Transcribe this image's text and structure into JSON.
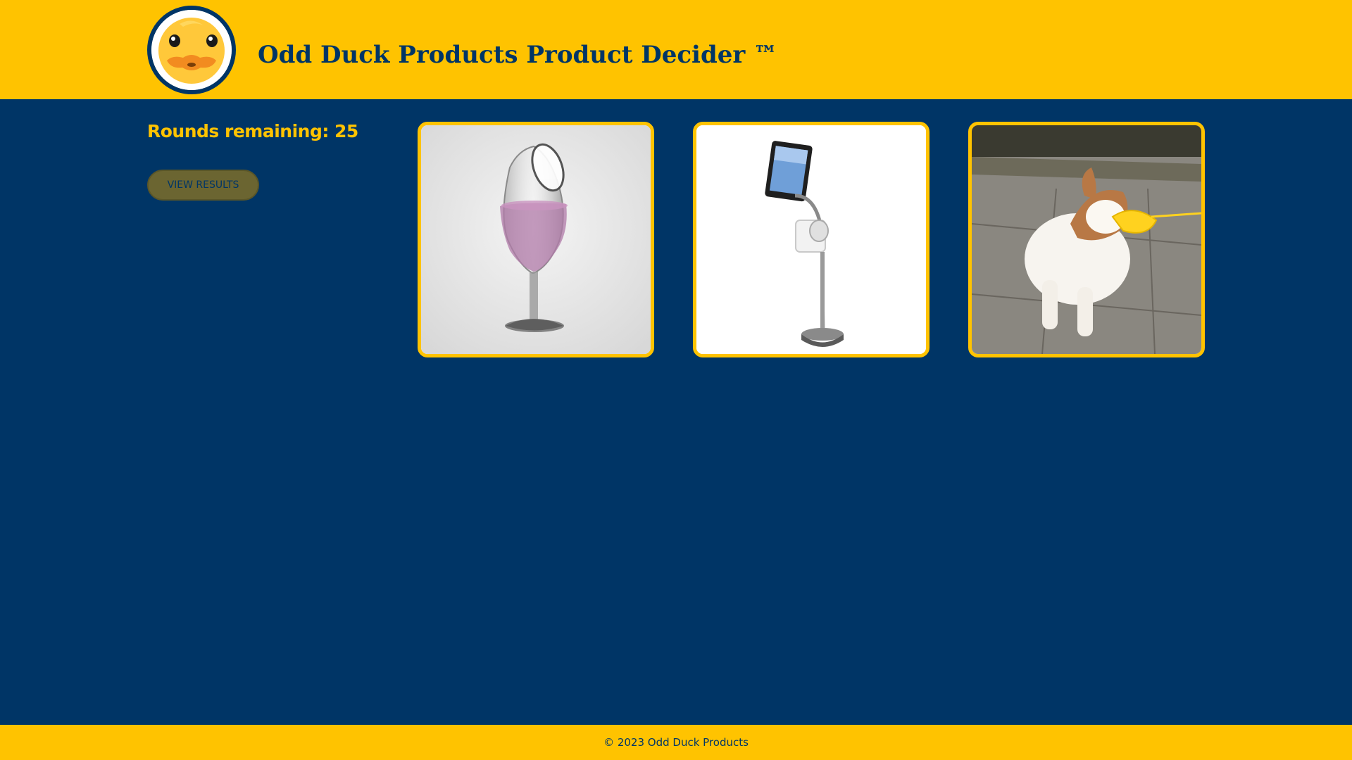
{
  "header": {
    "title": "Odd Duck Products Product Decider ™",
    "logo_icon": "duck-face-icon"
  },
  "sidebar": {
    "rounds_label": "Rounds remaining: 25",
    "results_button": "VIEW RESULTS"
  },
  "products": [
    {
      "icon": "wine-glass-image"
    },
    {
      "icon": "tablet-toilet-paper-stand-image"
    },
    {
      "icon": "dog-duck-muzzle-image"
    }
  ],
  "footer": {
    "copyright": "© 2023 Odd Duck Products"
  },
  "colors": {
    "brand_yellow": "#FFC300",
    "brand_navy": "#003566"
  }
}
